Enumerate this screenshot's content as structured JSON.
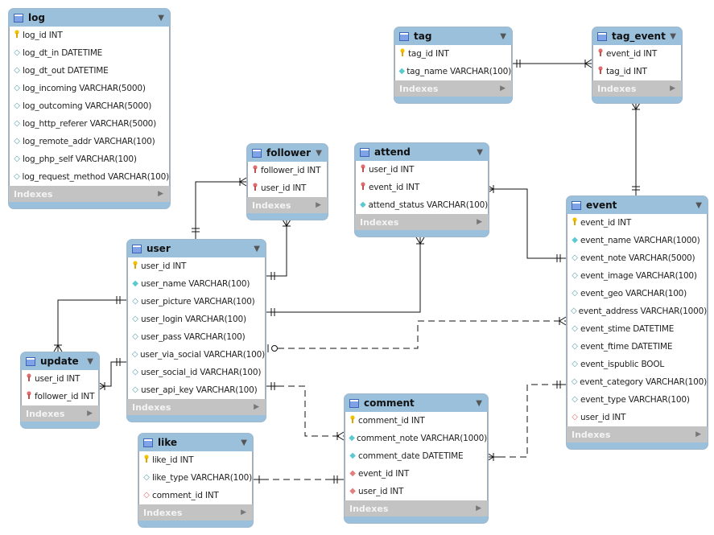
{
  "tables": [
    {
      "id": "log",
      "name": "log",
      "columns": [
        [
          "pk",
          "log_id INT"
        ],
        [
          "col",
          "log_dt_in DATETIME"
        ],
        [
          "col",
          "log_dt_out DATETIME"
        ],
        [
          "col",
          "log_incoming VARCHAR(5000)"
        ],
        [
          "col",
          "log_outcoming VARCHAR(5000)"
        ],
        [
          "col",
          "log_http_referer VARCHAR(5000)"
        ],
        [
          "col",
          "log_remote_addr VARCHAR(100)"
        ],
        [
          "col",
          "log_php_self VARCHAR(100)"
        ],
        [
          "col",
          "log_request_method VARCHAR(100)"
        ]
      ]
    },
    {
      "id": "tag",
      "name": "tag",
      "columns": [
        [
          "pk",
          "tag_id INT"
        ],
        [
          "nn",
          "tag_name VARCHAR(100)"
        ]
      ]
    },
    {
      "id": "tag_event",
      "name": "tag_event",
      "columns": [
        [
          "pkfk",
          "event_id INT"
        ],
        [
          "pkfk",
          "tag_id INT"
        ]
      ]
    },
    {
      "id": "follower",
      "name": "follower",
      "columns": [
        [
          "pkfk",
          "follower_id INT"
        ],
        [
          "pkfk",
          "user_id INT"
        ]
      ]
    },
    {
      "id": "attend",
      "name": "attend",
      "columns": [
        [
          "pkfk",
          "user_id INT"
        ],
        [
          "pkfk",
          "event_id INT"
        ],
        [
          "nn",
          "attend_status VARCHAR(100)"
        ]
      ]
    },
    {
      "id": "user",
      "name": "user",
      "columns": [
        [
          "pk",
          "user_id INT"
        ],
        [
          "nn",
          "user_name VARCHAR(100)"
        ],
        [
          "col",
          "user_picture VARCHAR(100)"
        ],
        [
          "col",
          "user_login VARCHAR(100)"
        ],
        [
          "col",
          "user_pass VARCHAR(100)"
        ],
        [
          "col",
          "user_via_social VARCHAR(100)"
        ],
        [
          "col",
          "user_social_id VARCHAR(100)"
        ],
        [
          "col",
          "user_api_key VARCHAR(100)"
        ]
      ]
    },
    {
      "id": "event",
      "name": "event",
      "columns": [
        [
          "pk",
          "event_id INT"
        ],
        [
          "nn",
          "event_name VARCHAR(1000)"
        ],
        [
          "col",
          "event_note VARCHAR(5000)"
        ],
        [
          "col",
          "event_image VARCHAR(100)"
        ],
        [
          "col",
          "event_geo VARCHAR(100)"
        ],
        [
          "col",
          "event_address VARCHAR(1000)"
        ],
        [
          "col",
          "event_stime DATETIME"
        ],
        [
          "col",
          "event_ftime DATETIME"
        ],
        [
          "col",
          "event_ispublic BOOL"
        ],
        [
          "col",
          "event_category VARCHAR(100)"
        ],
        [
          "col",
          "event_type VARCHAR(100)"
        ],
        [
          "fk",
          "user_id INT"
        ]
      ]
    },
    {
      "id": "update",
      "name": "update",
      "columns": [
        [
          "pkfk",
          "user_id INT"
        ],
        [
          "pkfk",
          "follower_id INT"
        ]
      ]
    },
    {
      "id": "like",
      "name": "like",
      "columns": [
        [
          "pk",
          "like_id INT"
        ],
        [
          "col",
          "like_type VARCHAR(100)"
        ],
        [
          "fk",
          "comment_id INT"
        ]
      ]
    },
    {
      "id": "comment",
      "name": "comment",
      "columns": [
        [
          "pk",
          "comment_id INT"
        ],
        [
          "nn",
          "comment_note VARCHAR(1000)"
        ],
        [
          "nn",
          "comment_date DATETIME"
        ],
        [
          "fknn",
          "event_id INT"
        ],
        [
          "fknn",
          "user_id INT"
        ]
      ]
    }
  ],
  "indexes_label": "Indexes",
  "colors": {
    "header": "#9ac0dc",
    "indexes": "#c3c3c3",
    "pk": "#f2c200",
    "fk": "#e07070",
    "nn": "#5cc8d0"
  }
}
